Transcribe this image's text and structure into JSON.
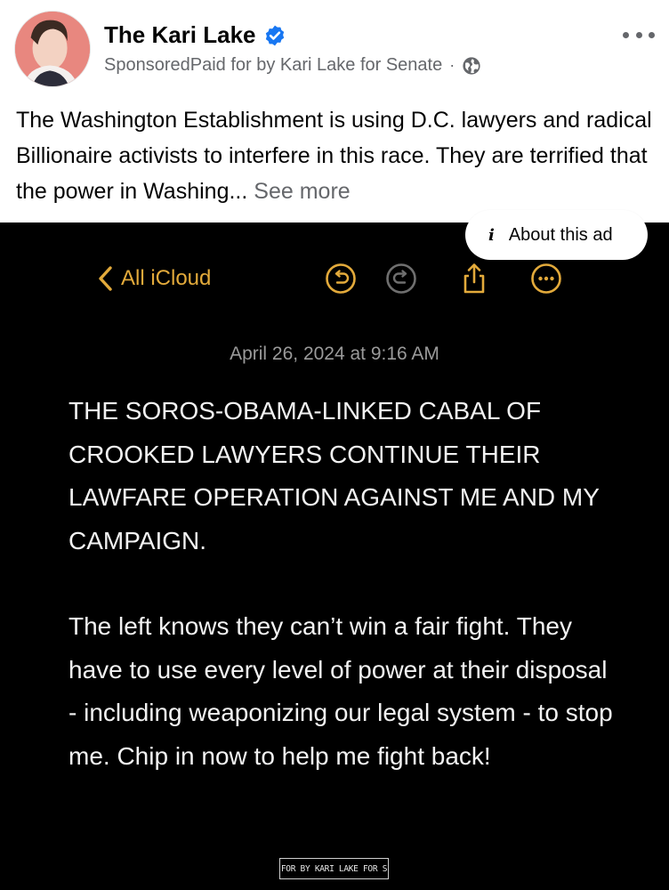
{
  "post": {
    "page_name": "The Kari Lake",
    "sponsored_line": "SponsoredPaid for by Kari Lake for Senate",
    "meta_separator": "·",
    "text": "The Washington Establishment is using D.C. lawyers and radical Billionaire activists to interfere in this race. They are terrified that the power in Washing...",
    "see_more": "See more",
    "icons": {
      "verified": "verified-badge-icon",
      "audience": "globe-icon",
      "menu": "more-options-icon"
    }
  },
  "ad": {
    "about_label": "About this ad",
    "about_icon": "i",
    "notes_app": {
      "back_label": "All iCloud",
      "toolbar_icons": [
        "undo-icon",
        "redo-icon",
        "share-icon",
        "more-icon"
      ],
      "accent_color": "#e3aa3b",
      "date": "April 26, 2024 at 9:16 AM",
      "paragraphs": [
        "THE SOROS-OBAMA-LINKED CABAL OF CROOKED LAWYERS CONTINUE THEIR LAWFARE OPERATION AGAINST ME AND MY CAMPAIGN.",
        "The left knows they can’t win a fair fight. They have to use every level of power at their disposal - including weaponizing our legal system - to stop me. Chip in now to help me fight back!"
      ]
    },
    "paid_for_label": "PAID FOR BY KARI LAKE FOR SENATE"
  },
  "colors": {
    "verified_blue": "#1877f2",
    "meta_gray": "#65676b",
    "ad_background": "#000000"
  }
}
